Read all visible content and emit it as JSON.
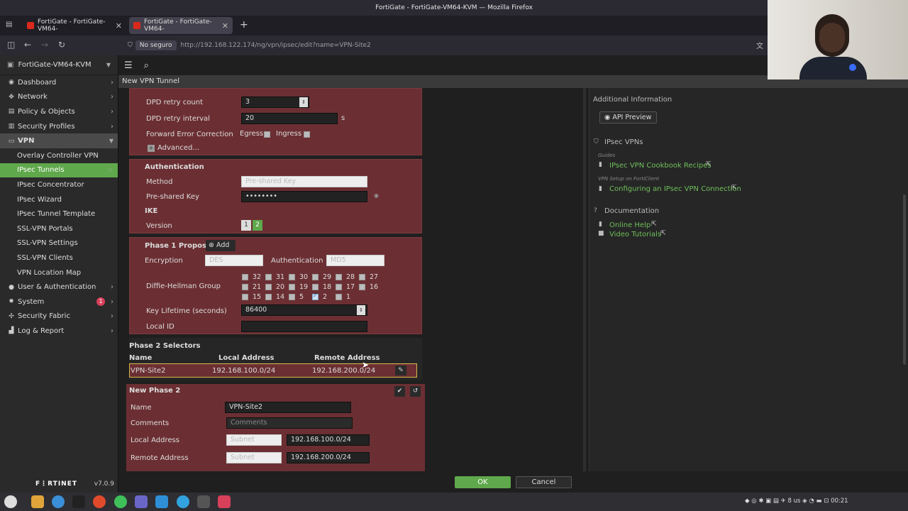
{
  "window": {
    "title": "FortiGate - FortiGate-VM64-KVM — Mozilla Firefox"
  },
  "tabs": [
    {
      "label": "FortiGate - FortiGate-VM64-",
      "active": false
    },
    {
      "label": "FortiGate - FortiGate-VM64-",
      "active": true
    }
  ],
  "address": {
    "security": "No seguro",
    "url": "http://192.168.122.174/ng/vpn/ipsec/edit?name=VPN-Site2"
  },
  "sidebar": {
    "device": "FortiGate-VM64-KVM",
    "items": [
      {
        "label": "Dashboard",
        "icon": "dashboard-icon"
      },
      {
        "label": "Network",
        "icon": "network-icon"
      },
      {
        "label": "Policy & Objects",
        "icon": "policy-icon"
      },
      {
        "label": "Security Profiles",
        "icon": "lock-icon"
      },
      {
        "label": "VPN",
        "icon": "monitor-icon"
      },
      {
        "label": "Overlay Controller VPN"
      },
      {
        "label": "IPsec Tunnels"
      },
      {
        "label": "IPsec Concentrator"
      },
      {
        "label": "IPsec Wizard"
      },
      {
        "label": "IPsec Tunnel Template"
      },
      {
        "label": "SSL-VPN Portals"
      },
      {
        "label": "SSL-VPN Settings"
      },
      {
        "label": "SSL-VPN Clients"
      },
      {
        "label": "VPN Location Map"
      },
      {
        "label": "User & Authentication",
        "icon": "user-icon"
      },
      {
        "label": "System",
        "icon": "gear-icon",
        "badge": "1"
      },
      {
        "label": "Security Fabric",
        "icon": "fabric-icon"
      },
      {
        "label": "Log & Report",
        "icon": "chart-icon"
      }
    ],
    "brand": "F⋮RTINET",
    "version": "v7.0.9"
  },
  "crumb": "New VPN Tunnel",
  "form": {
    "dpd_retry_count_label": "DPD retry count",
    "dpd_retry_count": "3",
    "dpd_retry_interval_label": "DPD retry interval",
    "dpd_retry_interval": "20",
    "dpd_unit": "s",
    "fec_label": "Forward Error Correction",
    "egress": "Egress",
    "ingress": "Ingress",
    "advanced": "Advanced...",
    "auth_title": "Authentication",
    "method_label": "Method",
    "method": "Pre-shared Key",
    "psk_label": "Pre-shared Key",
    "psk": "••••••••",
    "ike_title": "IKE",
    "version_label": "Version",
    "v1": "1",
    "v2": "2",
    "p1_title": "Phase 1 Proposal",
    "add": "Add",
    "encryption_label": "Encryption",
    "encryption": "DES",
    "authentication_label": "Authentication",
    "authentication": "MD5",
    "dh_label": "Diffie-Hellman Group",
    "dh_groups": [
      "32",
      "31",
      "30",
      "29",
      "28",
      "27",
      "21",
      "20",
      "19",
      "18",
      "17",
      "16",
      "15",
      "14",
      "5",
      "2",
      "1"
    ],
    "key_lifetime_label": "Key Lifetime (seconds)",
    "key_lifetime": "86400",
    "local_id_label": "Local ID",
    "local_id": "",
    "p2_title": "Phase 2 Selectors",
    "p2_cols": [
      "Name",
      "Local Address",
      "Remote Address"
    ],
    "p2_row": [
      "VPN-Site2",
      "192.168.100.0/24",
      "192.168.200.0/24"
    ],
    "np2_title": "New Phase 2",
    "name_label": "Name",
    "name": "VPN-Site2",
    "comments_label": "Comments",
    "comments_placeholder": "Comments",
    "local_addr_label": "Local Address",
    "local_type": "Subnet",
    "local_addr": "192.168.100.0/24",
    "remote_addr_label": "Remote Address",
    "remote_type": "Subnet",
    "remote_addr": "192.168.200.0/24"
  },
  "right": {
    "additional": "Additional Information",
    "api_preview": "API Preview",
    "ipsec_vpns": "IPsec VPNs",
    "guides": "Guides",
    "cookbook": "IPsec VPN Cookbook Recipes",
    "vpn_setup": "VPN Setup on FortiClient",
    "configuring": "Configuring an IPsec VPN Connection",
    "documentation": "Documentation",
    "online_help": "Online Help",
    "video": "Video Tutorials"
  },
  "buttons": {
    "ok": "OK",
    "cancel": "Cancel"
  },
  "tray": {
    "keyboard": "us",
    "battery": "8",
    "time": "00:21"
  }
}
